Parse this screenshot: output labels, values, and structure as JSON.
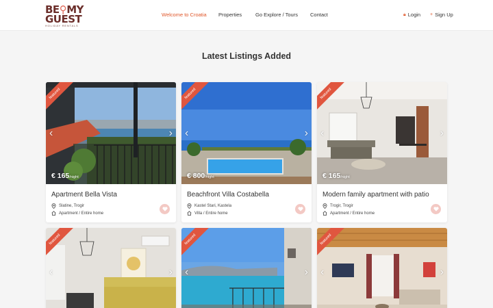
{
  "brand": {
    "line1_a": "BE",
    "line1_b": "MY",
    "line2": "GUEST",
    "tagline": "HOLIDAY RENTALS"
  },
  "nav": [
    {
      "label": "Welcome to Croatia",
      "active": true
    },
    {
      "label": "Properties"
    },
    {
      "label": "Go Explore / Tours"
    },
    {
      "label": "Contact"
    }
  ],
  "auth": {
    "login": "Login",
    "signup": "Sign Up"
  },
  "section_title": "Latest Listings Added",
  "listings": [
    {
      "badge": "featured",
      "price": "€ 165",
      "unit": "/night",
      "title": "Apartment Bella Vista",
      "location": "Slatine, Trogir",
      "type": "Apartment / Entire home"
    },
    {
      "badge": "featured",
      "price": "€ 800",
      "unit": "/night",
      "title": "Beachfront Villa Costabella",
      "location": "Kastel Stari, Kastela",
      "type": "Villa / Entire home"
    },
    {
      "badge": "featured",
      "price": "€ 165",
      "unit": "/night",
      "title": "Modern family apartment with patio",
      "location": "Trogir, Trogir",
      "type": "Apartment / Entire home"
    },
    {
      "badge": "featured"
    },
    {
      "badge": "featured"
    },
    {
      "badge": "featured"
    }
  ],
  "colors": {
    "accent": "#e0572a",
    "ribbon": "#e0563f",
    "fav_bg": "#f3c9c4",
    "brand": "#6b2e2a"
  }
}
